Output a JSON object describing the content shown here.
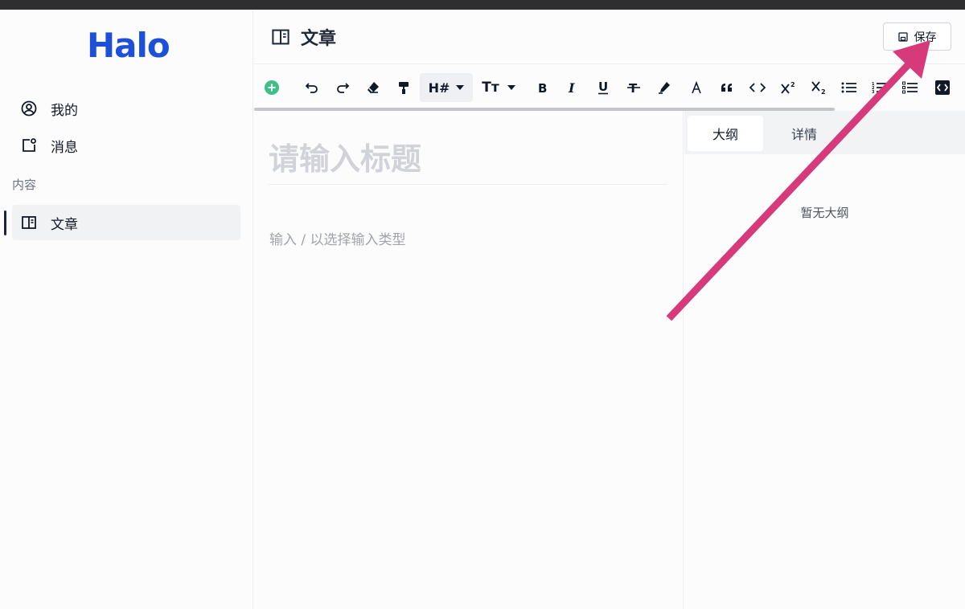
{
  "app": {
    "logo_text": "Halo",
    "accent": "#1e4fd8"
  },
  "sidebar": {
    "items": [
      {
        "label": "我的",
        "icon": "user-circle-icon"
      },
      {
        "label": "消息",
        "icon": "notification-icon"
      }
    ],
    "group_label": "内容",
    "active_item": {
      "label": "文章",
      "icon": "book-icon"
    }
  },
  "header": {
    "title": "文章",
    "title_icon": "book-icon",
    "save_label": "保存",
    "save_icon": "save-icon"
  },
  "toolbar": {
    "buttons": [
      "add-icon",
      "undo-icon",
      "redo-icon",
      "eraser-icon",
      "format-painter-icon",
      "heading-icon",
      "font-size-icon",
      "bold-icon",
      "italic-icon",
      "underline-icon",
      "strikethrough-icon",
      "highlight-icon",
      "font-color-icon",
      "quote-icon",
      "code-icon",
      "superscript-icon",
      "subscript-icon",
      "bullet-list-icon",
      "ordered-list-icon",
      "task-list-icon",
      "code-block-icon"
    ],
    "heading_label": "H#",
    "fontsize_label": "Tт"
  },
  "editor": {
    "title_placeholder": "请输入标题",
    "body_placeholder": "输入 / 以选择输入类型"
  },
  "panel": {
    "tabs": [
      {
        "label": "大纲"
      },
      {
        "label": "详情"
      }
    ],
    "empty_outline": "暂无大纲"
  },
  "annotation": {
    "arrow_color": "#d63a7a"
  }
}
